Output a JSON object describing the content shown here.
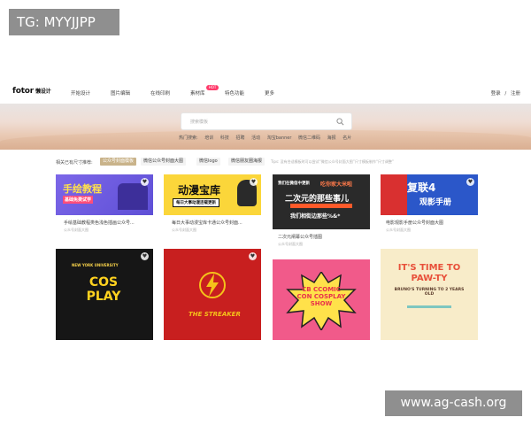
{
  "overlay": {
    "tg_label": "TG: MYYJJPP",
    "site_label": "www.ag-cash.org"
  },
  "nav": {
    "logo": "fotor",
    "logo_sub": "懒设计",
    "items": [
      "开始设计",
      "图片编辑",
      "在线印刷",
      "素材库",
      "特色功能",
      "更多"
    ],
    "hot_badge": "HOT",
    "login": "登录",
    "separator": "/",
    "register": "注册"
  },
  "search": {
    "placeholder": "搜索模板",
    "hot_label": "热门搜索:",
    "hot_tags": [
      "培训",
      "科技",
      "招聘",
      "活动",
      "淘宝banner",
      "微信二维码",
      "海报",
      "名片"
    ]
  },
  "filter": {
    "label": "相关已有尺寸推荐:",
    "chips": [
      "公众号封面模板",
      "微信公众号封面大图",
      "微信logo",
      "微信朋友圈海报"
    ],
    "active_index": 0,
    "tip": "Tips: 没有合适模板时可以尝试“微信公众号封面大图”尺寸模板制作“尺寸调整”"
  },
  "cards": [
    {
      "caption": "手绘基础教程类色浅色插画公众号...",
      "sub": "公众号封面大图",
      "art": "手绘教程",
      "art_sub": "基础免费试学"
    },
    {
      "caption": "每日大事动漫宝库卡通公众号封面...",
      "sub": "公众号封面大图",
      "art": "动漫宝库",
      "art_sub": "每日大事动漫连载更新"
    },
    {
      "caption": "二次元阐幕公众号插图",
      "sub": "公众号封面大图",
      "art": "二次元的那些事儿",
      "art_top": "我们在微信中更新",
      "art_hl": "吃你家大米啦",
      "art_sub": "我们相街边那些%&*"
    },
    {
      "caption": "电影观影手册公众号封面大图",
      "sub": "公众号封面大图",
      "art": "复联4",
      "art_sub": "观影手册"
    },
    {
      "caption": "",
      "sub": "",
      "art": "COS PLAY",
      "art_top": "NEW YORK UNIVERSITY"
    },
    {
      "caption": "",
      "sub": "",
      "art": "THE STREAKER"
    },
    {
      "caption": "",
      "sub": "",
      "art": "CB CCOMIC CON COSPLAY SHOW"
    },
    {
      "caption": "",
      "sub": "",
      "art": "IT'S TIME TO PAW-TY",
      "art_sub": "BRUNO'S TURNING TO 2 YEARS OLD"
    }
  ]
}
